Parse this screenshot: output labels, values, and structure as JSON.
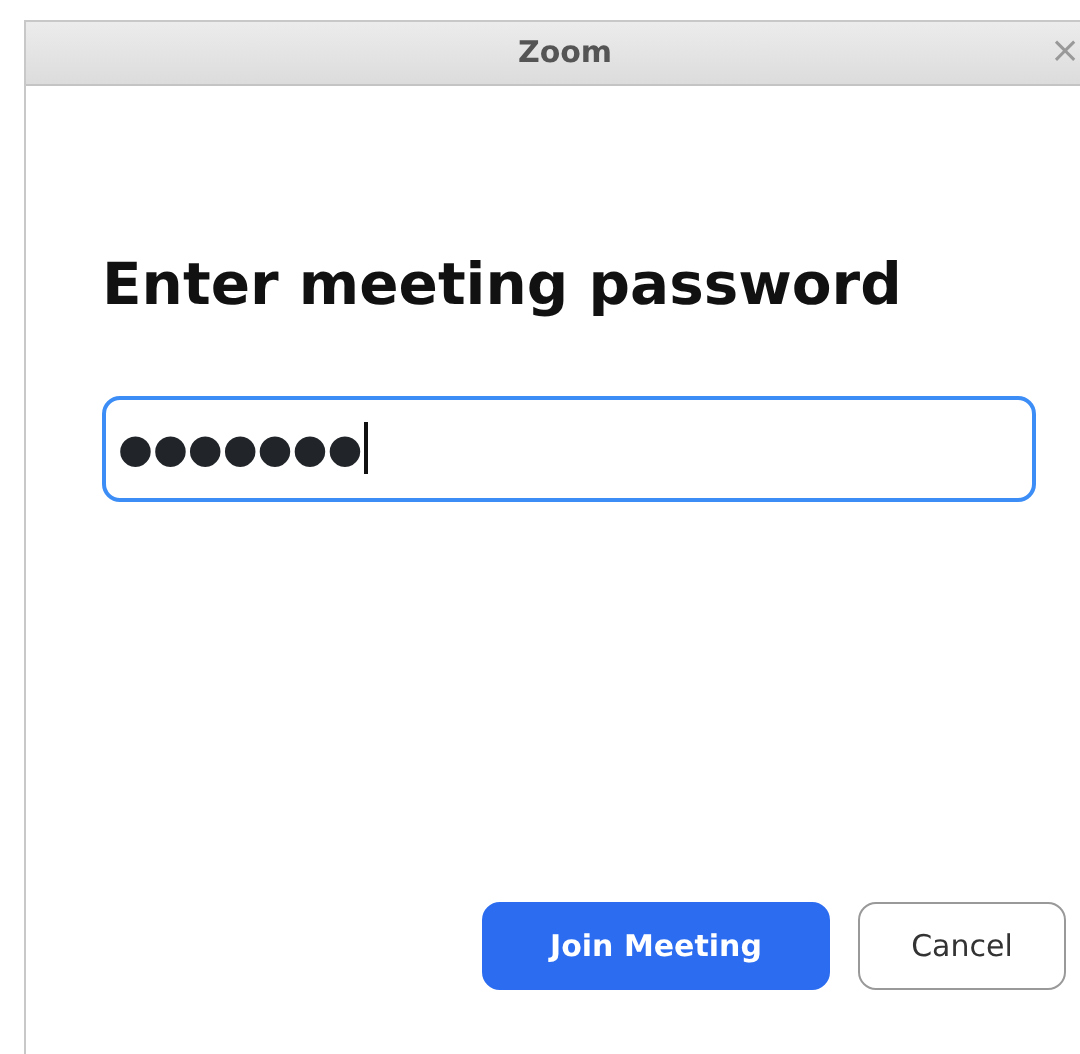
{
  "window": {
    "title": "Zoom",
    "close": "×"
  },
  "heading": "Enter meeting password",
  "password_field": {
    "value": "●●●●●●●",
    "focused": true
  },
  "buttons": [
    {
      "label": "Join Meeting",
      "kind": "primary"
    },
    {
      "label": "Cancel",
      "kind": "secondary"
    }
  ]
}
